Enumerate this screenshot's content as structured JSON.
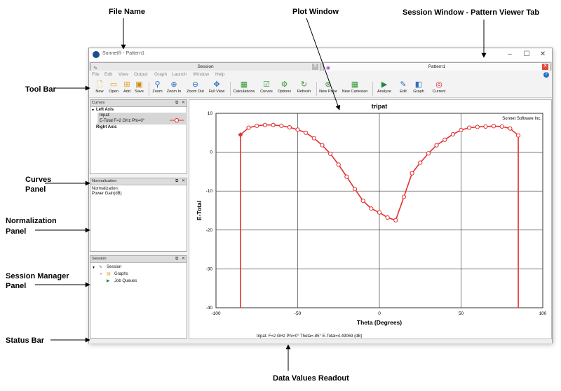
{
  "annotations": {
    "file_name": "File Name",
    "plot_window": "Plot Window",
    "session_window": "Session Window -  Pattern Viewer Tab",
    "tool_bar": "Tool Bar",
    "curves_panel_1": "Curves",
    "curves_panel_2": "Panel",
    "normalization_panel_1": "Normalization",
    "normalization_panel_2": "Panel",
    "session_manager_1": "Session Manager",
    "session_manager_2": "Panel",
    "status_bar": "Status Bar",
    "data_values": "Data Values Readout"
  },
  "window": {
    "title": "Sonnet® - Pattern1",
    "controls": [
      "–",
      "☐",
      "✕"
    ]
  },
  "tabs": [
    {
      "label": "Session",
      "close": "✕",
      "icon": "sonnet-wave-icon"
    },
    {
      "label": "Pattern1",
      "close": "✕",
      "icon": "pattern-icon"
    }
  ],
  "menu": [
    "File",
    "Edit",
    "View",
    "Output",
    "Graph",
    "Launch",
    "Window",
    "Help"
  ],
  "toolbar": {
    "items": [
      {
        "label": "New",
        "icon": "new-file-icon"
      },
      {
        "label": "Open",
        "icon": "open-folder-icon"
      },
      {
        "label": "Add",
        "icon": "add-folder-icon"
      },
      {
        "label": "Save",
        "icon": "save-icon"
      },
      {
        "label": "Zoom",
        "icon": "zoom-icon"
      },
      {
        "label": "Zoom In",
        "icon": "zoom-in-icon"
      },
      {
        "label": "Zoom Out",
        "icon": "zoom-out-icon"
      },
      {
        "label": "Full View",
        "icon": "full-view-icon"
      },
      {
        "label": "Calculations",
        "icon": "calculator-icon"
      },
      {
        "label": "Curves",
        "icon": "curves-icon"
      },
      {
        "label": "Options",
        "icon": "options-gear-icon"
      },
      {
        "label": "Refresh",
        "icon": "refresh-icon"
      },
      {
        "label": "New Polar",
        "icon": "polar-icon"
      },
      {
        "label": "New Cartesian",
        "icon": "cartesian-grid-icon"
      },
      {
        "label": "Analyze",
        "icon": "analyze-play-icon"
      },
      {
        "label": "Edit",
        "icon": "edit-icon"
      },
      {
        "label": "Graph",
        "icon": "graph-icon"
      },
      {
        "label": "Current",
        "icon": "current-spiral-icon"
      }
    ]
  },
  "curves_panel": {
    "title": "Curves",
    "left_axis": "Left Axis",
    "curve_file": "tripat:",
    "curve_desc": "E-Total  F=2 GHz  Phi=0°",
    "right_axis": "Right Axis"
  },
  "normalization_panel": {
    "title": "Normalization",
    "line1": "Normalization:",
    "line2": "Power Gain(dB)"
  },
  "session_panel": {
    "title": "Session",
    "root": "Session",
    "graphs": "Graphs",
    "job_queues": "Job Queues"
  },
  "status": {
    "readout": "tripat:   F=2 GHz  Phi=0°  Theta=-85°  E-Total=4.49069 (dB)"
  },
  "colors": {
    "curve": "#e53030",
    "accent": "#1b4f8a"
  },
  "chart_data": {
    "type": "line",
    "title": "tripat",
    "annotation": "Sonnet Software Inc.",
    "xlabel": "Theta (Degrees)",
    "ylabel": "E-Total",
    "xlim": [
      -100,
      100
    ],
    "ylim": [
      -40,
      10
    ],
    "xticks": [
      -100,
      -50,
      0,
      50,
      100
    ],
    "yticks": [
      10,
      0,
      -10,
      -20,
      -30,
      -40
    ],
    "grid": true,
    "series": [
      {
        "name": "E-Total  F=2 GHz  Phi=0°",
        "x": [
          -85,
          -85,
          -80,
          -75,
          -70,
          -65,
          -60,
          -55,
          -50,
          -45,
          -40,
          -35,
          -30,
          -25,
          -20,
          -15,
          -10,
          -5,
          0,
          5,
          10,
          15,
          20,
          25,
          30,
          35,
          40,
          45,
          50,
          55,
          60,
          65,
          70,
          75,
          80,
          85,
          85
        ],
        "y": [
          -40,
          4.5,
          6.3,
          6.8,
          7.0,
          7.0,
          6.8,
          6.4,
          5.8,
          5.0,
          3.6,
          1.8,
          -0.4,
          -3.2,
          -6.3,
          -9.5,
          -12.5,
          -14.5,
          -15.5,
          -16.8,
          -17.5,
          -11.5,
          -5.4,
          -2.7,
          -0.3,
          1.8,
          3.2,
          4.6,
          5.7,
          6.3,
          6.5,
          6.6,
          6.7,
          6.6,
          6.1,
          4.3,
          -40
        ]
      }
    ]
  }
}
